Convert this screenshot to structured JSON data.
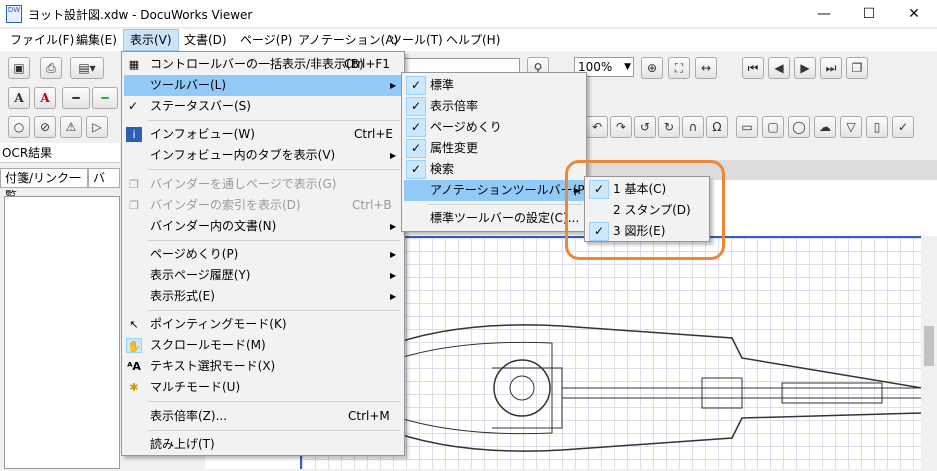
{
  "window": {
    "app_icon_text": "DW",
    "title": "ヨット設計図.xdw - DocuWorks Viewer",
    "minimize": "—",
    "maximize": "☐",
    "close": "✕"
  },
  "menubar": [
    "ファイル(F)",
    "編集(E)",
    "表示(V)",
    "文書(D)",
    "ページ(P)",
    "アノテーション(A)",
    "ツール(T)",
    "ヘルプ(H)"
  ],
  "toolbar": {
    "zoom_value": "100%",
    "text_a_black": "A",
    "text_a_red": "A"
  },
  "left_pane": {
    "title": "OCR結果",
    "tab1": "付箋/リンク一覧",
    "tab2": "バイン"
  },
  "view_menu": {
    "items": [
      {
        "label": "コントロールバーの一括表示/非表示(B)",
        "shortcut": "Ctrl+F1",
        "icon": "control-bar-icon"
      },
      {
        "label": "ツールバー(L)",
        "submenu": true
      },
      {
        "label": "ステータスバー(S)",
        "checked": true
      },
      {
        "label": "インフォビュー(W)",
        "shortcut": "Ctrl+E",
        "icon": "infoview-icon"
      },
      {
        "label": "インフォビュー内のタブを表示(V)",
        "submenu": true
      },
      {
        "label": "バインダーを通しページで表示(G)",
        "disabled": true,
        "icon": "binder-pages-icon"
      },
      {
        "label": "バインダーの索引を表示(D)",
        "shortcut": "Ctrl+B",
        "disabled": true,
        "icon": "binder-index-icon"
      },
      {
        "label": "バインダー内の文書(N)",
        "submenu": true
      },
      {
        "label": "ページめくり(P)",
        "submenu": true
      },
      {
        "label": "表示ページ履歴(Y)",
        "submenu": true
      },
      {
        "label": "表示形式(E)",
        "submenu": true
      },
      {
        "label": "ポインティングモード(K)",
        "icon": "pointer-icon"
      },
      {
        "label": "スクロールモード(M)",
        "icon": "hand-icon"
      },
      {
        "label": "テキスト選択モード(X)",
        "icon": "text-select-icon"
      },
      {
        "label": "マルチモード(U)",
        "icon": "multi-mode-icon"
      },
      {
        "label": "表示倍率(Z)...",
        "shortcut": "Ctrl+M"
      },
      {
        "label": "読み上げ(T)"
      }
    ]
  },
  "toolbar_submenu": {
    "items": [
      {
        "label": "標準",
        "checked": true
      },
      {
        "label": "表示倍率",
        "checked": true
      },
      {
        "label": "ページめくり",
        "checked": true
      },
      {
        "label": "属性変更",
        "checked": true
      },
      {
        "label": "検索",
        "checked": true
      },
      {
        "label": "アノテーションツールバー(P)",
        "submenu": true
      },
      {
        "label": "標準ツールバーの設定(C)..."
      }
    ]
  },
  "annotation_submenu": {
    "items": [
      {
        "label": "1 基本(C)",
        "checked": true
      },
      {
        "label": "2 スタンプ(D)",
        "checked": false
      },
      {
        "label": "3 図形(E)",
        "checked": true
      }
    ]
  },
  "colors": {
    "highlight": "#91c9f7",
    "callout": "#ee8638",
    "page_border": "#2a62c9"
  }
}
